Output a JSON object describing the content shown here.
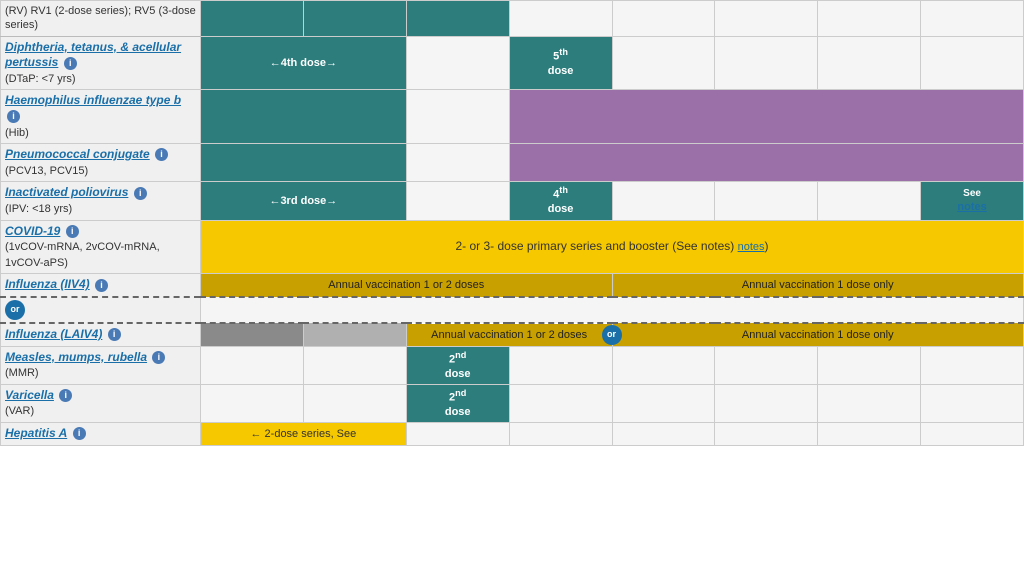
{
  "table": {
    "rows": [
      {
        "id": "rv",
        "vaccine_name": null,
        "vaccine_text": "(RV) RV1 (2-dose series); RV5 (3-dose series)",
        "is_link": false,
        "info": false
      },
      {
        "id": "dtap",
        "vaccine_name": "Diphtheria, tetanus, & acellular pertussis",
        "vaccine_sub": "(DTaP: <7 yrs)",
        "is_link": true,
        "info": true,
        "cells": [
          "teal",
          "teal",
          "dose4_label",
          "empty",
          "dose5",
          "empty",
          "empty",
          "empty"
        ]
      },
      {
        "id": "hib",
        "vaccine_name": "Haemophilus influenzae type b",
        "vaccine_sub": "(Hib)",
        "is_link": true,
        "info": true,
        "cells": [
          "teal",
          "teal",
          "empty",
          "empty",
          "purple",
          "purple",
          "purple",
          "purple"
        ]
      },
      {
        "id": "pcv",
        "vaccine_name": "Pneumococcal conjugate",
        "vaccine_sub": "(PCV13, PCV15)",
        "is_link": true,
        "info": true,
        "cells": [
          "teal",
          "teal",
          "empty",
          "empty",
          "purple",
          "purple",
          "purple",
          "purple"
        ]
      },
      {
        "id": "ipv",
        "vaccine_name": "Inactivated poliovirus",
        "vaccine_sub": "(IPV: <18 yrs)",
        "is_link": true,
        "info": true,
        "cells": [
          "teal",
          "teal",
          "dose3_label",
          "empty",
          "dose4_ipv",
          "empty",
          "empty",
          "see_notes"
        ]
      },
      {
        "id": "covid",
        "vaccine_name": "COVID-19",
        "vaccine_sub": "(1vCOV-mRNA, 2vCOV-mRNA, 1vCOV-aPS)",
        "is_link": true,
        "info": true,
        "cells_span": "2- or 3- dose primary series and booster (See notes)"
      },
      {
        "id": "flu_iiv4",
        "vaccine_name": "Influenza (IIV4)",
        "is_link": true,
        "info": true,
        "cells_text_left": "Annual vaccination 1 or 2 doses",
        "cells_text_right": "Annual vaccination 1 dose only"
      },
      {
        "id": "flu_laiv4",
        "vaccine_name": "Influenza (LAIV4)",
        "is_link": true,
        "info": true,
        "cells_text_left": "Annual vaccination 1 or 2 doses",
        "cells_text_right": "Annual vaccination 1 dose only"
      },
      {
        "id": "mmr",
        "vaccine_name": "Measles, mumps, rubella",
        "vaccine_sub": "(MMR)",
        "is_link": true,
        "info": true,
        "dose_label": "2nd dose"
      },
      {
        "id": "var",
        "vaccine_name": "Varicella",
        "vaccine_sub": "(VAR)",
        "is_link": true,
        "info": true,
        "dose_label": "2nd dose"
      },
      {
        "id": "hepa",
        "vaccine_name": "Hepatitis A",
        "is_link": true,
        "info": true,
        "cells_text": "← 2-dose series, See"
      }
    ],
    "covid_notes_label": "notes",
    "see_notes_label": "notes",
    "dose4_arrow": "←4th dose→",
    "dose5_label": "5th\ndose",
    "dose3_arrow": "←3rd dose→",
    "dose4_ipv_label": "4th\ndose",
    "see_notes_text": "See\nnotes",
    "or_label": "or"
  }
}
